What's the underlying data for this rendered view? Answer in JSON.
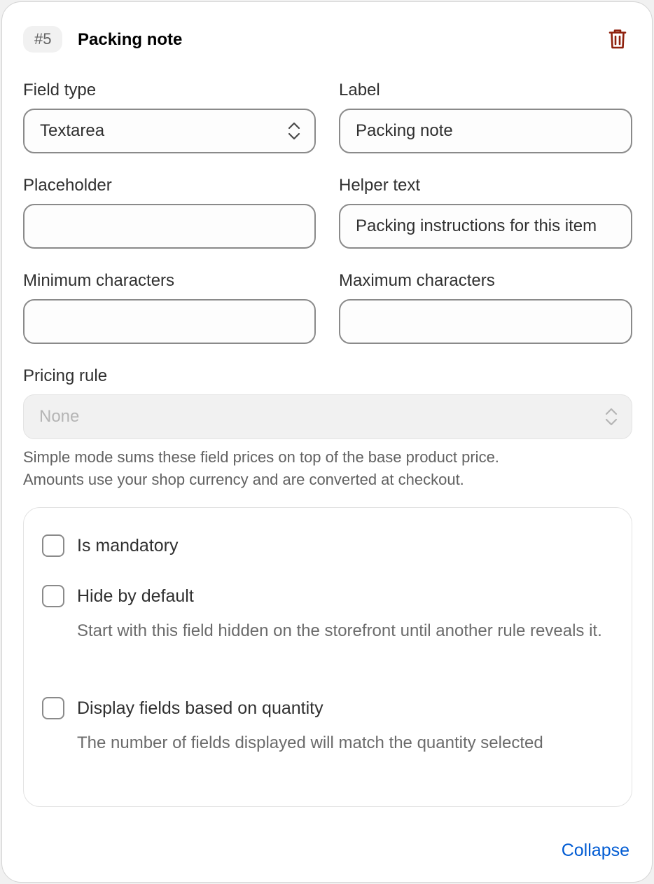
{
  "header": {
    "badge": "#5",
    "title": "Packing note"
  },
  "fields": {
    "field_type": {
      "label": "Field type",
      "value": "Textarea"
    },
    "label": {
      "label": "Label",
      "value": "Packing note"
    },
    "placeholder": {
      "label": "Placeholder",
      "value": ""
    },
    "helper_text": {
      "label": "Helper text",
      "value": "Packing instructions for this item"
    },
    "min_chars": {
      "label": "Minimum characters",
      "value": ""
    },
    "max_chars": {
      "label": "Maximum characters",
      "value": ""
    },
    "pricing_rule": {
      "label": "Pricing rule",
      "value": "None"
    }
  },
  "pricing_help": [
    "Simple mode sums these field prices on top of the base product price.",
    "Amounts use your shop currency and are converted at checkout."
  ],
  "options": [
    {
      "label": "Is mandatory",
      "checked": false,
      "description": ""
    },
    {
      "label": "Hide by default",
      "checked": false,
      "description": "Start with this field hidden on the storefront until another rule reveals it."
    },
    {
      "label": "Display fields based on quantity",
      "checked": false,
      "description": "The number of fields displayed will match the quantity selected"
    }
  ],
  "footer": {
    "collapse_label": "Collapse"
  },
  "colors": {
    "delete_icon": "#8e1f0b",
    "link": "#005bd3",
    "disabled_bg": "#f1f1f1"
  }
}
